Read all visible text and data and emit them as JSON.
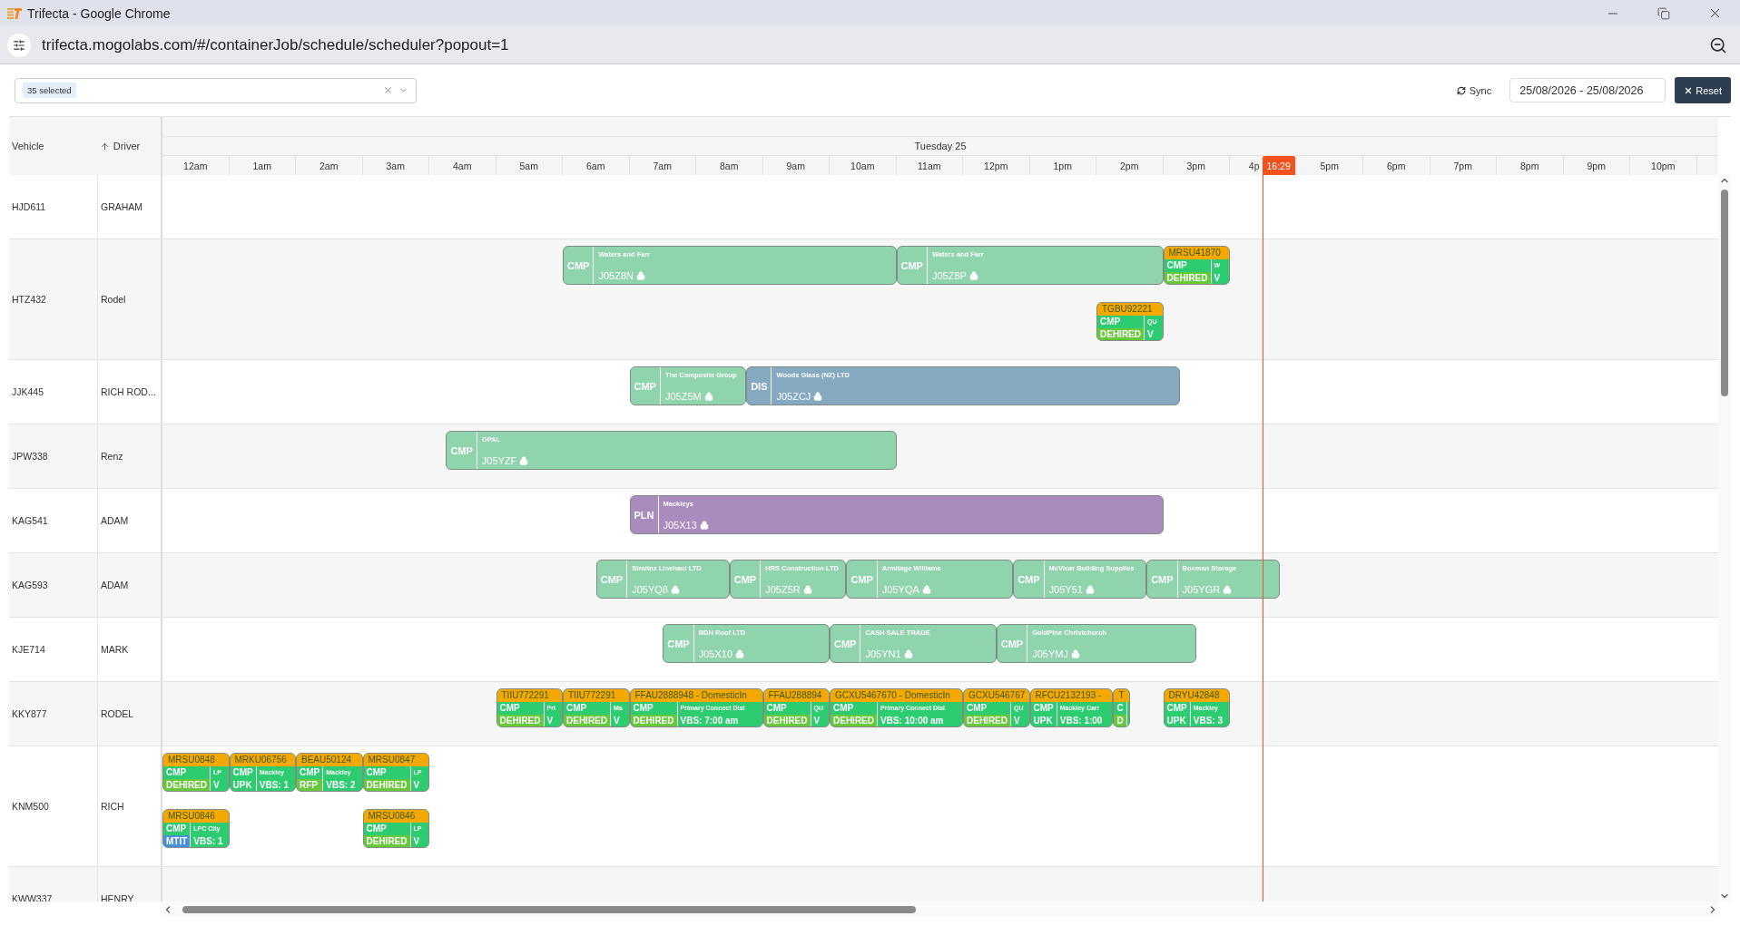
{
  "browser": {
    "title": "Trifecta - Google Chrome",
    "url": "trifecta.mogolabs.com/#/containerJob/schedule/scheduler?popout=1"
  },
  "toolbar": {
    "filter_chip": "35 selected",
    "sync": "Sync",
    "date_range": "25/08/2026 - 25/08/2026",
    "reset": "Reset"
  },
  "scheduler": {
    "columns": [
      {
        "label": "Vehicle",
        "sorted": false
      },
      {
        "label": "Driver",
        "sorted": true
      }
    ],
    "day": "Tuesday 25",
    "hours": [
      "12am",
      "1am",
      "2am",
      "3am",
      "4am",
      "5am",
      "6am",
      "7am",
      "8am",
      "9am",
      "10am",
      "11am",
      "12pm",
      "1pm",
      "2pm",
      "3pm",
      "4p",
      "5pm",
      "6pm",
      "7pm",
      "8pm",
      "9pm",
      "10pm"
    ],
    "now": "16:29",
    "rows": [
      {
        "vehicle": "HJD611",
        "driver": "GRAHAM"
      },
      {
        "vehicle": "HTZ432",
        "driver": "Rodel",
        "lanes": [
          [
            {
              "kind": "job",
              "type": "CMP",
              "customer": "Waters and Farr",
              "job": "J05Z8N",
              "locked": true,
              "color": "#90d4ad"
            },
            {
              "kind": "job",
              "type": "CMP",
              "customer": "Waters and Farr",
              "job": "J05Z8P",
              "locked": true,
              "color": "#90d4ad"
            },
            {
              "kind": "container",
              "container": "MRSU41870",
              "type": "CMP",
              "status": "DEHIRED",
              "color": "#66c93a",
              "customer": "W",
              "vbs": "V"
            }
          ],
          [
            {
              "kind": "container",
              "container": "TGBU92221",
              "type": "CMP",
              "status": "DEHIRED",
              "color": "#66c93a",
              "customer": "QU",
              "vbs": "V"
            }
          ]
        ]
      },
      {
        "vehicle": "JJK445",
        "driver": "RICH ROD...",
        "lanes": [
          [
            {
              "kind": "job",
              "type": "CMP",
              "customer": "The Composite Group",
              "job": "J05Z5M",
              "locked": true,
              "color": "#90d4ad"
            },
            {
              "kind": "job",
              "type": "DIS",
              "customer": "Woods Glass (NZ) LTD",
              "job": "J05ZCJ",
              "locked": true,
              "color": "#84a9c1"
            }
          ]
        ]
      },
      {
        "vehicle": "JPW338",
        "driver": "Renz",
        "lanes": [
          [
            {
              "kind": "job",
              "type": "CMP",
              "customer": "OPAL",
              "job": "J05YZF",
              "locked": true,
              "color": "#90d4ad"
            }
          ]
        ]
      },
      {
        "vehicle": "KAG541",
        "driver": "ADAM",
        "lanes": [
          [
            {
              "kind": "job",
              "type": "PLN",
              "customer": "Mackleys",
              "job": "J05X13",
              "locked": true,
              "color": "#a98bbd"
            }
          ]
        ]
      },
      {
        "vehicle": "KAG593",
        "driver": "ADAM",
        "lanes": [
          [
            {
              "kind": "job",
              "type": "CMP",
              "customer": "Straitnz Linehaul LTD",
              "job": "J05YQ8",
              "locked": true,
              "color": "#90d4ad"
            },
            {
              "kind": "job",
              "type": "CMP",
              "customer": "HRS Construction LTD",
              "job": "J05Z5R",
              "locked": true,
              "color": "#90d4ad"
            },
            {
              "kind": "job",
              "type": "CMP",
              "customer": "Armitage Williams",
              "job": "J05YQA",
              "locked": true,
              "color": "#90d4ad"
            },
            {
              "kind": "job",
              "type": "CMP",
              "customer": "McVicar Building Supplies",
              "job": "J05Y51",
              "locked": true,
              "color": "#90d4ad"
            },
            {
              "kind": "job",
              "type": "CMP",
              "customer": "Boxman Storage",
              "job": "J05YGR",
              "locked": true,
              "color": "#90d4ad"
            }
          ]
        ]
      },
      {
        "vehicle": "KJE714",
        "driver": "MARK",
        "lanes": [
          [
            {
              "kind": "job",
              "type": "CMP",
              "customer": "BDH Roof LTD",
              "job": "J05X10",
              "locked": true,
              "color": "#90d4ad"
            },
            {
              "kind": "job",
              "type": "CMP",
              "customer": "CASH SALE TRADE",
              "job": "J05YN1",
              "locked": true,
              "color": "#90d4ad"
            },
            {
              "kind": "job",
              "type": "CMP",
              "customer": "GoldPine Christchurch",
              "job": "J05YMJ",
              "locked": true,
              "color": "#90d4ad"
            }
          ]
        ]
      },
      {
        "vehicle": "KKY877",
        "driver": "RODEL",
        "lanes": [
          [
            {
              "kind": "container",
              "container": "TIIU772291",
              "type": "CMP",
              "status": "DEHIRED",
              "color": "#66c93a",
              "customer": "Pri",
              "vbs": "V"
            },
            {
              "kind": "container",
              "container": "TIIU772291",
              "type": "CMP",
              "status": "DEHIRED",
              "color": "#66c93a",
              "customer": "Ma",
              "vbs": "V"
            },
            {
              "kind": "container",
              "container": "FFAU2888948 - DomesticIn",
              "type": "CMP",
              "status": "DEHIRED",
              "color": "#66c93a",
              "customer": "Primary Connect Dist",
              "vbs": "VBS: 7:00 am"
            },
            {
              "kind": "container",
              "container": "FFAU288894",
              "type": "CMP",
              "status": "DEHIRED",
              "color": "#66c93a",
              "customer": "QU",
              "vbs": "V"
            },
            {
              "kind": "container",
              "container": "GCXU5467670 - DomesticIn",
              "type": "CMP",
              "status": "DEHIRED",
              "color": "#66c93a",
              "customer": "Primary Connect Dist",
              "vbs": "VBS: 10:00 am"
            },
            {
              "kind": "container",
              "container": "GCXU546767",
              "type": "CMP",
              "status": "DEHIRED",
              "color": "#66c93a",
              "customer": "QU",
              "vbs": "V"
            },
            {
              "kind": "container",
              "container": "RFCU2132193 -",
              "type": "CMP",
              "status": "UPK",
              "color": "#2ecc71",
              "customer": "Mackley Carr",
              "vbs": "VBS: 1:00"
            },
            {
              "kind": "container",
              "container": "T",
              "type": "C",
              "status": "D",
              "color": "#66c93a"
            },
            {
              "kind": "container",
              "container": "DRYU42848",
              "type": "CMP",
              "status": "UPK",
              "color": "#2ecc71",
              "customer": "Mackley",
              "vbs": "VBS: 3"
            }
          ]
        ]
      },
      {
        "vehicle": "KNM500",
        "driver": "RICH",
        "lanes": [
          [
            {
              "kind": "container",
              "container": "MRSU0848",
              "type": "CMP",
              "status": "DEHIRED",
              "color": "#66c93a",
              "customer": "LP",
              "vbs": "V"
            },
            {
              "kind": "container",
              "container": "MRKU06756",
              "type": "CMP",
              "status": "UPK",
              "color": "#2ecc71",
              "customer": "Mackley",
              "vbs": "VBS: 1"
            },
            {
              "kind": "container",
              "container": "BEAU50124",
              "type": "CMP",
              "status": "RFP",
              "color": "#66c93a",
              "customer": "Mackley",
              "vbs": "VBS: 2"
            },
            {
              "kind": "container",
              "container": "MRSU0847",
              "type": "CMP",
              "status": "DEHIRED",
              "color": "#66c93a",
              "customer": "LP",
              "vbs": "V"
            }
          ],
          [
            {
              "kind": "container",
              "container": "MRSU0846",
              "type": "CMP",
              "status": "MTIT",
              "color": "#4a90d9",
              "customer": "LPC City",
              "vbs": "VBS: 1"
            },
            {
              "kind": "container",
              "container": "MRSU0846",
              "type": "CMP",
              "status": "DEHIRED",
              "color": "#66c93a",
              "customer": "LP",
              "vbs": "V"
            }
          ]
        ]
      },
      {
        "vehicle": "KWW337",
        "driver": "HENRY"
      }
    ]
  }
}
